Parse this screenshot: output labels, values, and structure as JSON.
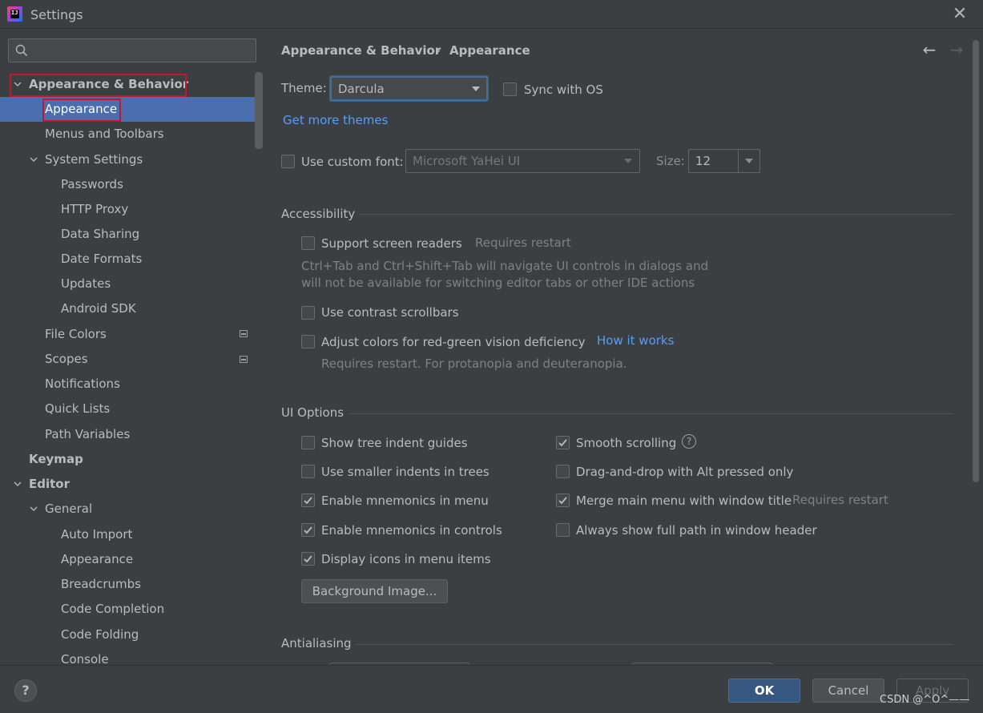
{
  "window": {
    "title": "Settings"
  },
  "search": {
    "placeholder": "",
    "value": ""
  },
  "sidebar": {
    "items": [
      {
        "label": "Appearance & Behavior"
      },
      {
        "label": "Appearance"
      },
      {
        "label": "Menus and Toolbars"
      },
      {
        "label": "System Settings"
      },
      {
        "label": "Passwords"
      },
      {
        "label": "HTTP Proxy"
      },
      {
        "label": "Data Sharing"
      },
      {
        "label": "Date Formats"
      },
      {
        "label": "Updates"
      },
      {
        "label": "Android SDK"
      },
      {
        "label": "File Colors"
      },
      {
        "label": "Scopes"
      },
      {
        "label": "Notifications"
      },
      {
        "label": "Quick Lists"
      },
      {
        "label": "Path Variables"
      },
      {
        "label": "Keymap"
      },
      {
        "label": "Editor"
      },
      {
        "label": "General"
      },
      {
        "label": "Auto Import"
      },
      {
        "label": "Appearance"
      },
      {
        "label": "Breadcrumbs"
      },
      {
        "label": "Code Completion"
      },
      {
        "label": "Code Folding"
      },
      {
        "label": "Console"
      }
    ]
  },
  "header": {
    "crumb_parent": "Appearance & Behavior",
    "crumb_sep": "›",
    "crumb_current": "Appearance"
  },
  "theme": {
    "label": "Theme:",
    "value": "Darcula",
    "sync_label": "Sync with OS",
    "sync_checked": false,
    "more_link": "Get more themes"
  },
  "font": {
    "label": "Use custom font:",
    "checked": false,
    "value": "Microsoft YaHei UI",
    "size_label": "Size:",
    "size_value": "12"
  },
  "accessibility": {
    "title": "Accessibility",
    "screen_readers": "Support screen readers",
    "screen_readers_hint": "Requires restart",
    "screen_readers_desc1": "Ctrl+Tab and Ctrl+Shift+Tab will navigate UI controls in dialogs and",
    "screen_readers_desc2": "will not be available for switching editor tabs or other IDE actions",
    "contrast": "Use contrast scrollbars",
    "vision": "Adjust colors for red-green vision deficiency",
    "vision_link": "How it works",
    "vision_desc": "Requires restart. For protanopia and deuteranopia."
  },
  "ui_options": {
    "title": "UI Options",
    "left": [
      {
        "label": "Show tree indent guides",
        "checked": false
      },
      {
        "label": "Use smaller indents in trees",
        "checked": false
      },
      {
        "label": "Enable mnemonics in menu",
        "checked": true
      },
      {
        "label": "Enable mnemonics in controls",
        "checked": true
      },
      {
        "label": "Display icons in menu items",
        "checked": true
      }
    ],
    "right": [
      {
        "label": "Smooth scrolling",
        "checked": true
      },
      {
        "label": "Drag-and-drop with Alt pressed only",
        "checked": false
      },
      {
        "label": "Merge main menu with window title",
        "checked": true,
        "hint": "Requires restart"
      },
      {
        "label": "Always show full path in window header",
        "checked": false
      }
    ],
    "background_button": "Background Image..."
  },
  "antialiasing": {
    "title": "Antialiasing"
  },
  "footer": {
    "help": "?",
    "ok": "OK",
    "cancel": "Cancel",
    "apply": "Apply",
    "watermark": "CSDN @^O^——"
  },
  "colors": {
    "selection": "#4b6eaf",
    "link": "#589df6",
    "primary_button": "#365880",
    "highlight_box": "#c0172a"
  }
}
